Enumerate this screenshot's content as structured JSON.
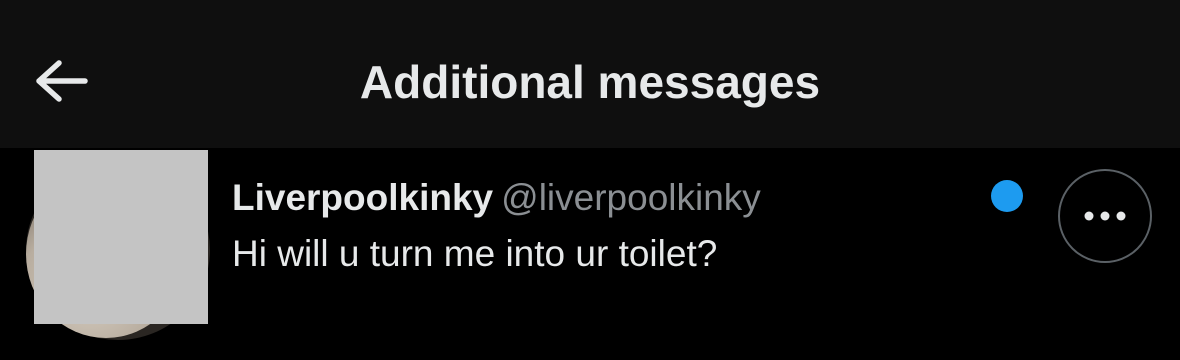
{
  "header": {
    "title": "Additional messages",
    "back_icon": "arrow-left-icon"
  },
  "conversation": {
    "display_name": "Liverpoolkinky",
    "handle": "@liverpoolkinky",
    "message": "Hi will u turn me into ur toilet?",
    "unread": true,
    "more_icon": "more-horizontal-icon"
  },
  "colors": {
    "background": "#000000",
    "header_background": "#0f0f0f",
    "text_primary": "#e7e9ea",
    "text_secondary": "#8b8f93",
    "accent_blue": "#1d9bf0",
    "redaction": "#c4c4c4"
  }
}
